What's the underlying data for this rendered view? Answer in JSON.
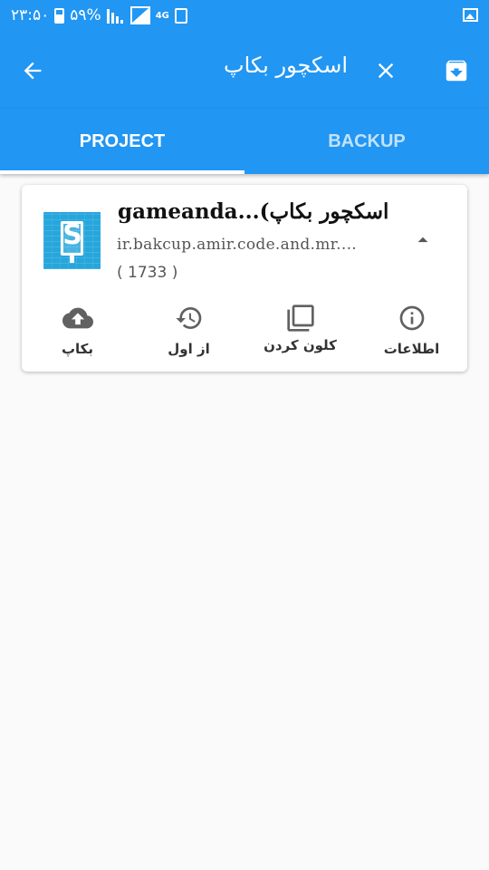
{
  "status_bar": {
    "time": "۲۳:۵۰",
    "battery": "۵۹%",
    "network": "4G"
  },
  "app_bar": {
    "search_query": "اسکچور بکاپ",
    "icons": [
      "arrow-back-icon",
      "close-icon",
      "archive-download-icon"
    ]
  },
  "tabs": [
    {
      "label": "PROJECT",
      "active": true
    },
    {
      "label": "BACKUP",
      "active": false
    }
  ],
  "card": {
    "title": "gameanda...(اسکچور بکاپ",
    "package": "ir.bakcup.amir.code.and.mr....",
    "version": "( 1733 )",
    "actions": [
      {
        "label": "اطلاعات",
        "icon": "info-icon"
      },
      {
        "label": "کلون کردن",
        "icon": "clone-icon"
      },
      {
        "label": "از اول",
        "icon": "restore-history-icon"
      },
      {
        "label": "بکاپ",
        "icon": "cloud-upload-icon"
      }
    ]
  },
  "colors": {
    "primary": "#2196f3",
    "background": "#fafafa",
    "icon_tile": "#27a6dc"
  }
}
